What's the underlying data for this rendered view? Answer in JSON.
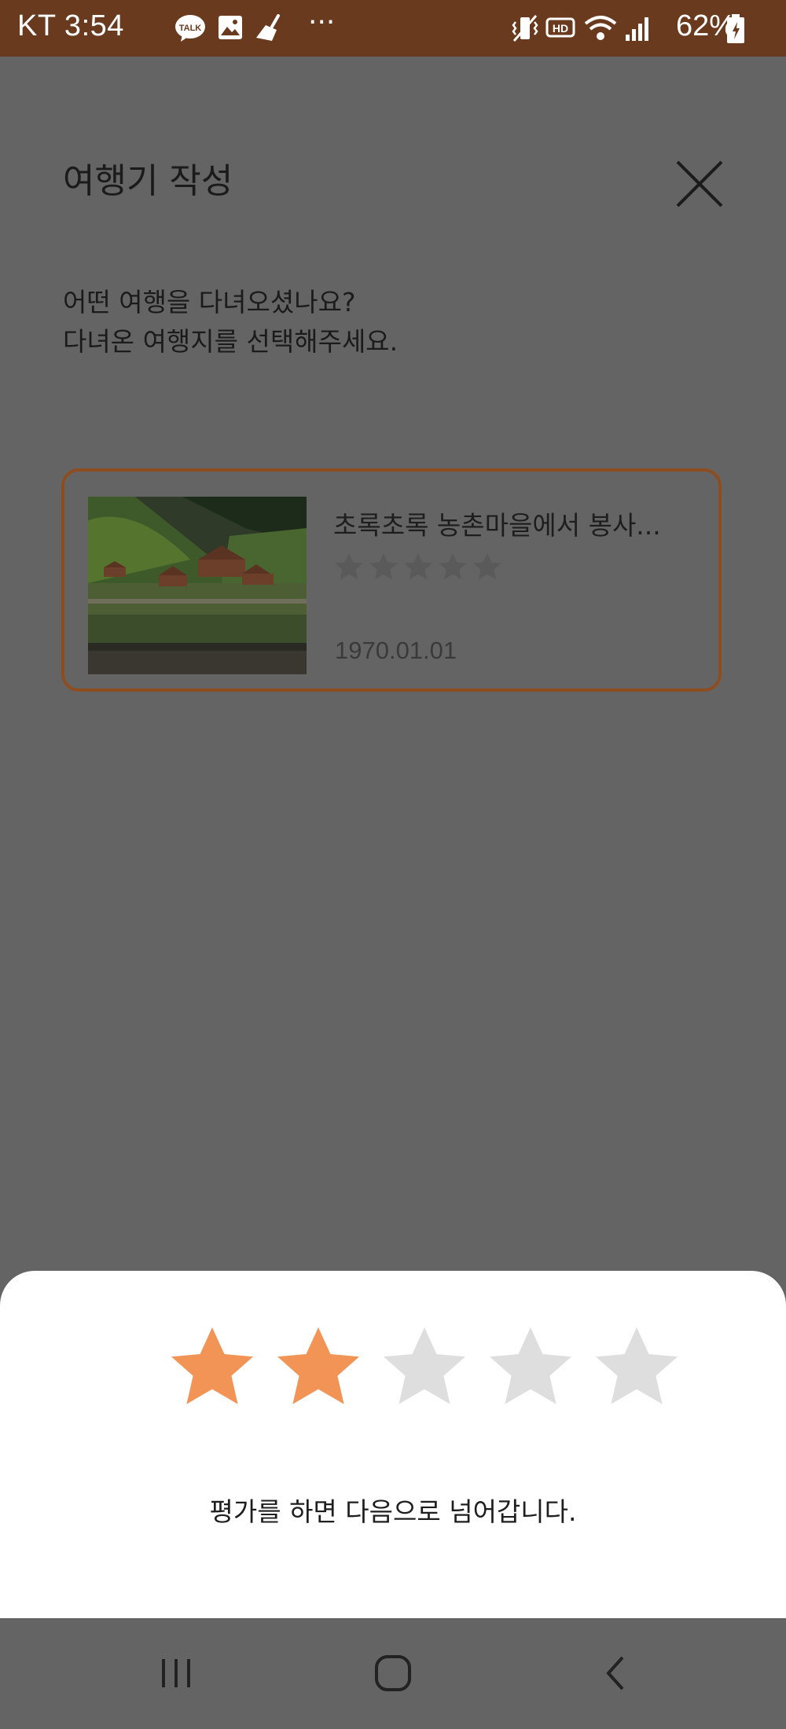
{
  "status_bar": {
    "carrier_time": "KT 3:54",
    "talk_badge": "TALK",
    "more": "···",
    "hd_badge": "HD",
    "battery_percent": "62%"
  },
  "page": {
    "title": "여행기 작성",
    "prompt_line1": "어떤 여행을 다녀오셨나요?",
    "prompt_line2": "다녀온 여행지를 선택해주세요.",
    "close_icon": "close-icon"
  },
  "trip_card": {
    "title": "초록초록 농촌마을에서 봉사...",
    "rating_filled": 0,
    "rating_max": 5,
    "date": "1970.01.01",
    "border_color": "#8e4d1f"
  },
  "sheet": {
    "rating_selected": 2,
    "rating_max": 5,
    "message": "평가를 하면 다음으로 넘어갑니다.",
    "star_active_color": "#f29455",
    "star_inactive_color": "#dedede"
  },
  "nav_bar": {
    "recents_icon": "recents-icon",
    "home_icon": "home-icon",
    "back_icon": "back-icon"
  }
}
